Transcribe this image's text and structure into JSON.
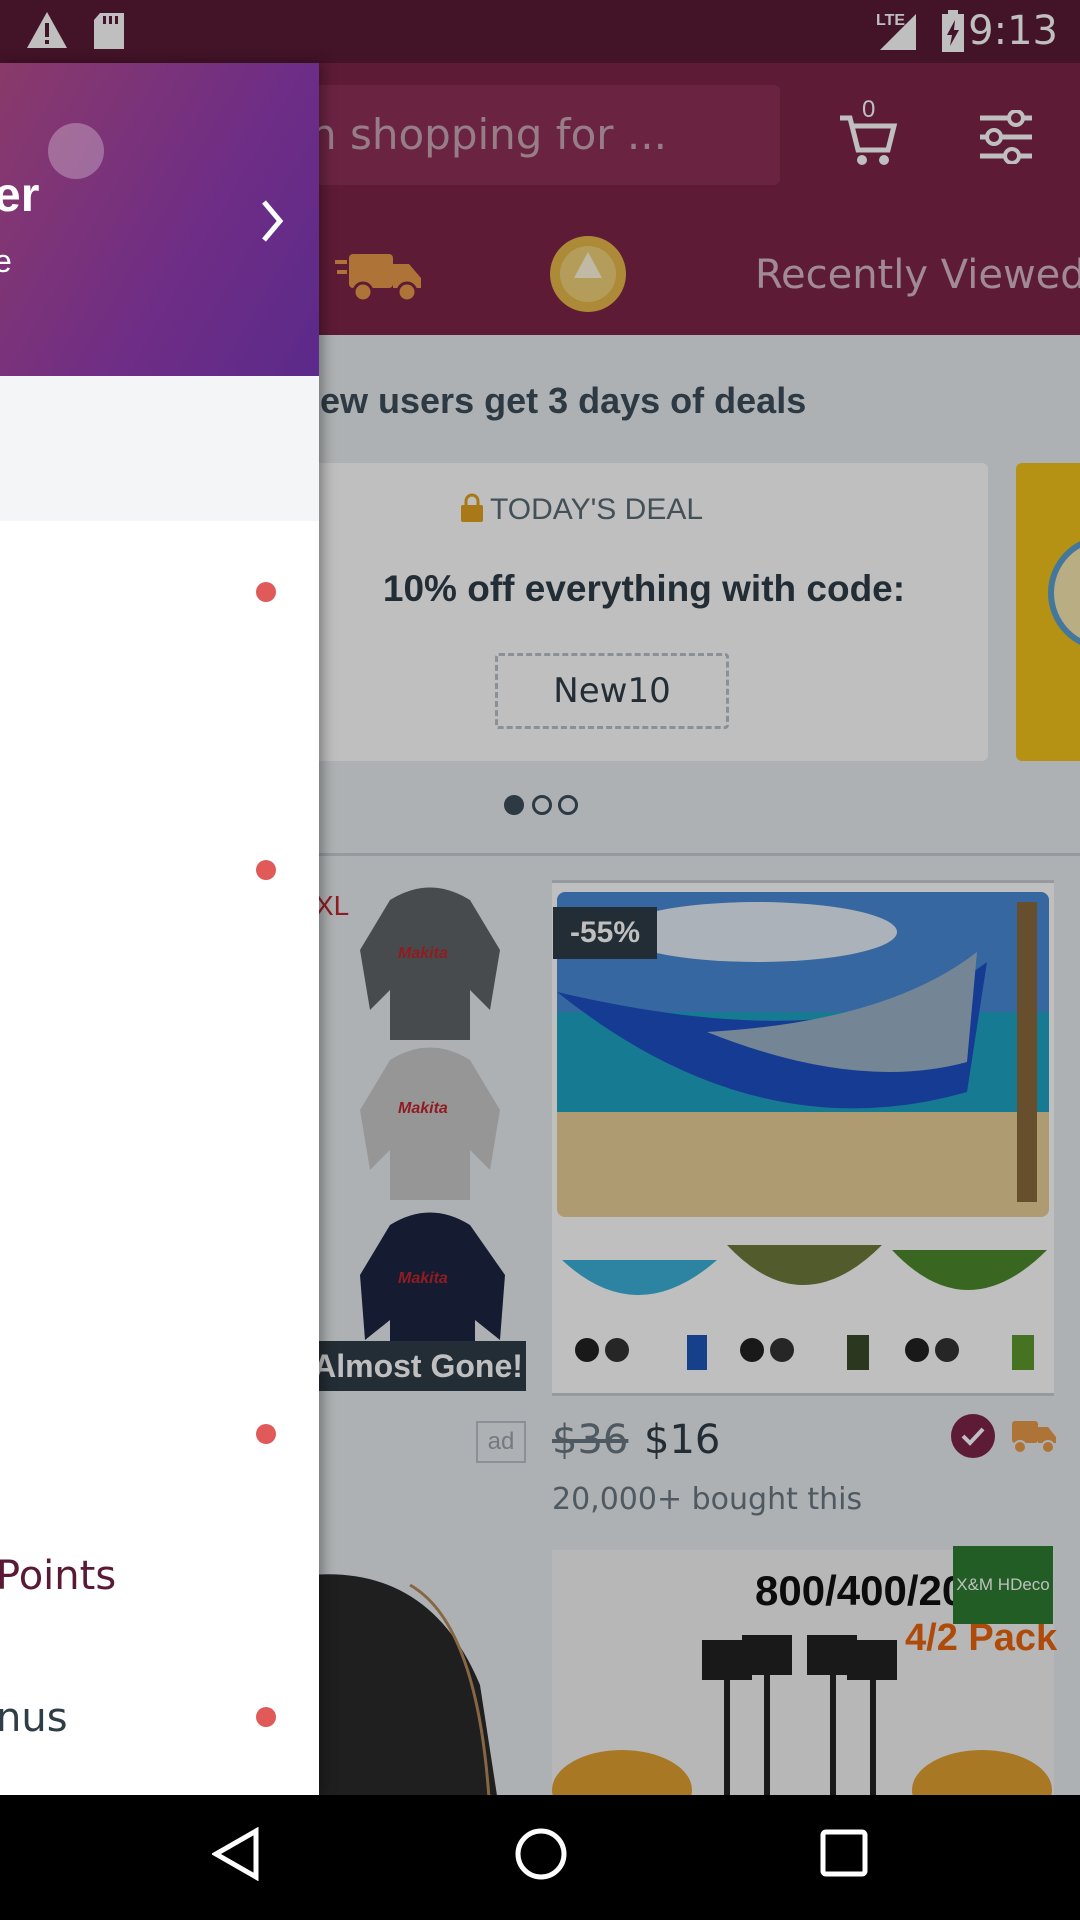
{
  "status_bar": {
    "time": "9:13",
    "network": "LTE"
  },
  "header": {
    "search_placeholder": "n shopping for ...",
    "cart_count": "0",
    "recently_viewed": "Recently Viewed"
  },
  "promo": {
    "banner": "ew users get 3 days of deals",
    "deal_label": "TODAY'S DEAL",
    "deal_title": "10% off everything with code:",
    "coupon_code": "New10"
  },
  "products": {
    "left": {
      "size_tag": "XL",
      "badge": "Almost Gone!",
      "ad": "ad",
      "hoodie_text": "Makita"
    },
    "right": {
      "discount": "-55%",
      "price_old": "$36",
      "price_new": "$16",
      "bought": "20,000+ bought this"
    },
    "bottom": {
      "title": "800/400/20",
      "subtitle": "4/2 Pack",
      "brand": "X&M HDeco"
    }
  },
  "drawer": {
    "name": "er",
    "subtitle": "e",
    "points_label": "Points",
    "bonus_label": "nus"
  },
  "colors": {
    "brand": "#7c2449",
    "accent_red": "#e05a5a",
    "dark_text": "#2f3d47"
  }
}
